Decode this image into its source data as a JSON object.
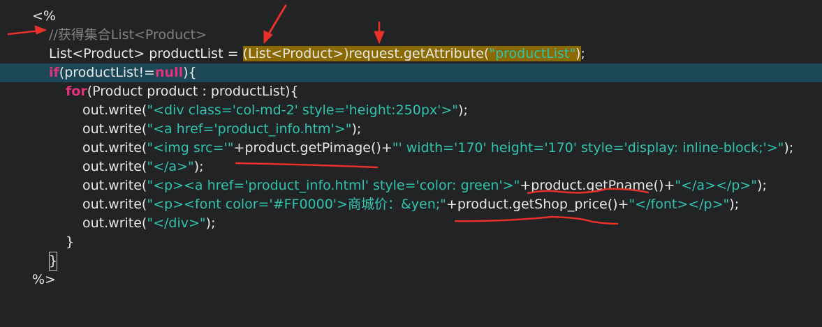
{
  "editor": {
    "lines": [
      {
        "open_tag": "<%"
      },
      {
        "comment": "//获得集合List<Product>"
      },
      {
        "decl": "List<Product> productList = ",
        "cast": "(List<Product>)request.getAttribute(",
        "arg": "\"productList\"",
        "close": ")",
        "end": ";"
      },
      {
        "kw_if": "if",
        "cond_a": "(productList!=",
        "kw_null": "null",
        "cond_b": "){"
      },
      {
        "kw_for": "for",
        "loop": "(Product product : productList){"
      },
      {
        "a": "out.write(",
        "s": "\"<div class='col-md-2' style='height:250px'>\"",
        "b": ");"
      },
      {
        "a": "out.write(",
        "s": "\"<a href='product_info.htm'>\"",
        "b": ");"
      },
      {
        "a": "out.write(",
        "s1": "\"<img src='\"",
        "op1": "+",
        "expr": "product.getPimage()",
        "op2": "+",
        "s2": "\"' width='170' height='170' style='display: inline-block;'>\"",
        "b": ");"
      },
      {
        "a": "out.write(",
        "s": "\"</a>\"",
        "b": ");"
      },
      {
        "a": "out.write(",
        "s1": "\"<p><a href='product_info.html' style='color: green'>\"",
        "op1": "+",
        "expr": "product.getPname()",
        "op2": "+",
        "s2": "\"</a></p>\"",
        "b": ");"
      },
      {
        "a": "out.write(",
        "s1": "\"<p><font color='#FF0000'>商城价：&yen;\"",
        "op1": "+",
        "expr": "product.getShop_price()",
        "op2": "+",
        "s2": "\"</font></p>\"",
        "b": ");"
      },
      {
        "a": "out.write(",
        "s": "\"</div>\"",
        "b": ");"
      },
      {
        "brace": "}"
      },
      {
        "brace": "}"
      },
      {
        "close_tag": "%>"
      }
    ]
  },
  "colors": {
    "background": "#222324",
    "current_line": "#1c4756",
    "keyword": "#e0317a",
    "string": "#2fc3b0",
    "comment": "#808080",
    "highlight": "#8a6a00",
    "annotation_red": "#e8312a"
  }
}
